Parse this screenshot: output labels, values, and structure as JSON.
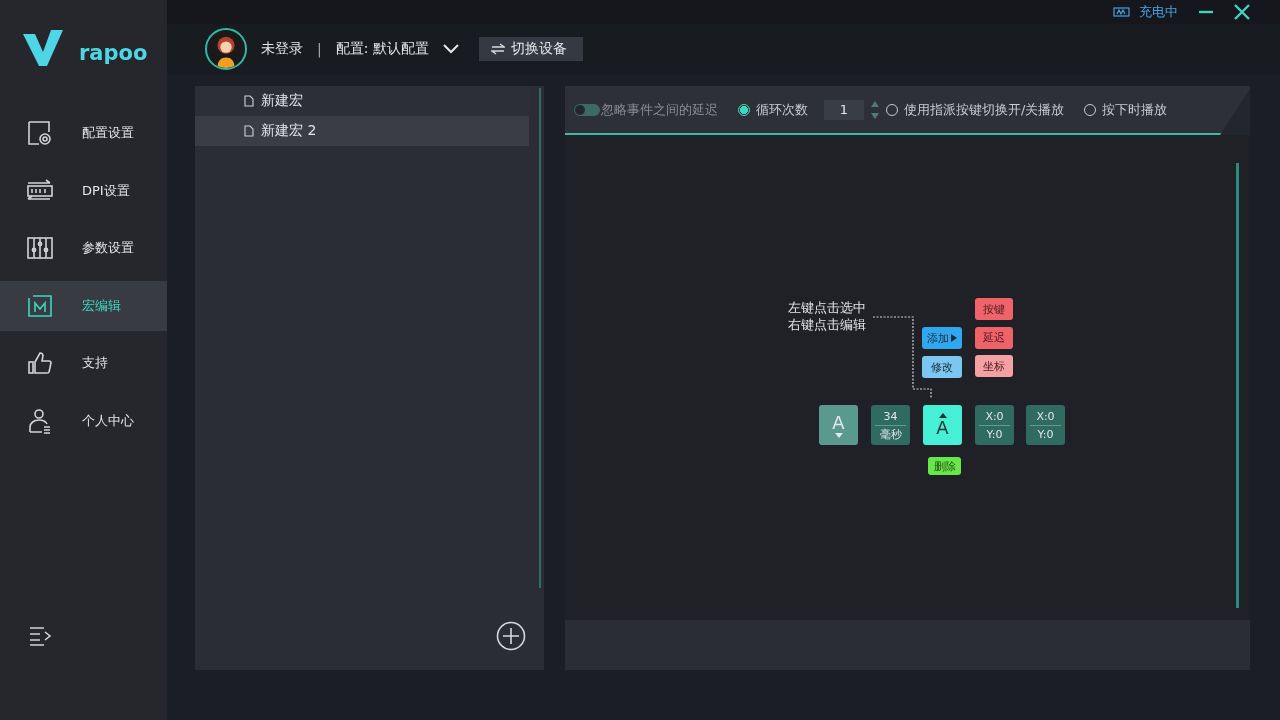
{
  "logo": {
    "text": "rapoo"
  },
  "title_bar": {
    "battery_status": "充电中"
  },
  "top_bar": {
    "user": "未登录",
    "separator": "|",
    "profile": "配置: 默认配置",
    "switch_button": "切换设备"
  },
  "sidebar": {
    "items": [
      {
        "label": "配置设置",
        "selected": false
      },
      {
        "label": "DPI设置",
        "selected": false
      },
      {
        "label": "参数设置",
        "selected": false
      },
      {
        "label": "宏编辑",
        "selected": true
      },
      {
        "label": "支持",
        "selected": false
      },
      {
        "label": "个人中心",
        "selected": false
      }
    ]
  },
  "macro_list": [
    {
      "name": "新建宏",
      "selected": false
    },
    {
      "name": "新建宏 2",
      "selected": true
    }
  ],
  "toolbar": {
    "ignore_delay": {
      "label": "忽略事件之间的延迟",
      "on": false
    },
    "loop": {
      "label": "循环次数",
      "selected": true,
      "count": "1"
    },
    "modes": [
      {
        "label": "使用指派按键切换开/关播放",
        "selected": false
      },
      {
        "label": "按下时播放",
        "selected": false
      }
    ]
  },
  "editor": {
    "hint": [
      "左键点击选中",
      "右键点击编辑"
    ],
    "actions": [
      {
        "label": "添加",
        "kind": "add"
      },
      {
        "label": "修改",
        "kind": "edit"
      }
    ],
    "submenu": [
      {
        "label": "按键",
        "color": "#f0636b"
      },
      {
        "label": "延迟",
        "color": "#ef6268"
      },
      {
        "label": "坐标",
        "color": "#f5a0a3"
      }
    ],
    "sequence": [
      {
        "kind": "key_press",
        "label": "A",
        "selected": false
      },
      {
        "kind": "delay",
        "value": "34",
        "unit": "毫秒"
      },
      {
        "kind": "key_release",
        "label": "A",
        "selected": true
      },
      {
        "kind": "coord",
        "x": "X:0",
        "y": "Y:0"
      },
      {
        "kind": "coord",
        "x": "X:0",
        "y": "Y:0"
      }
    ],
    "delete_button": "删除"
  }
}
